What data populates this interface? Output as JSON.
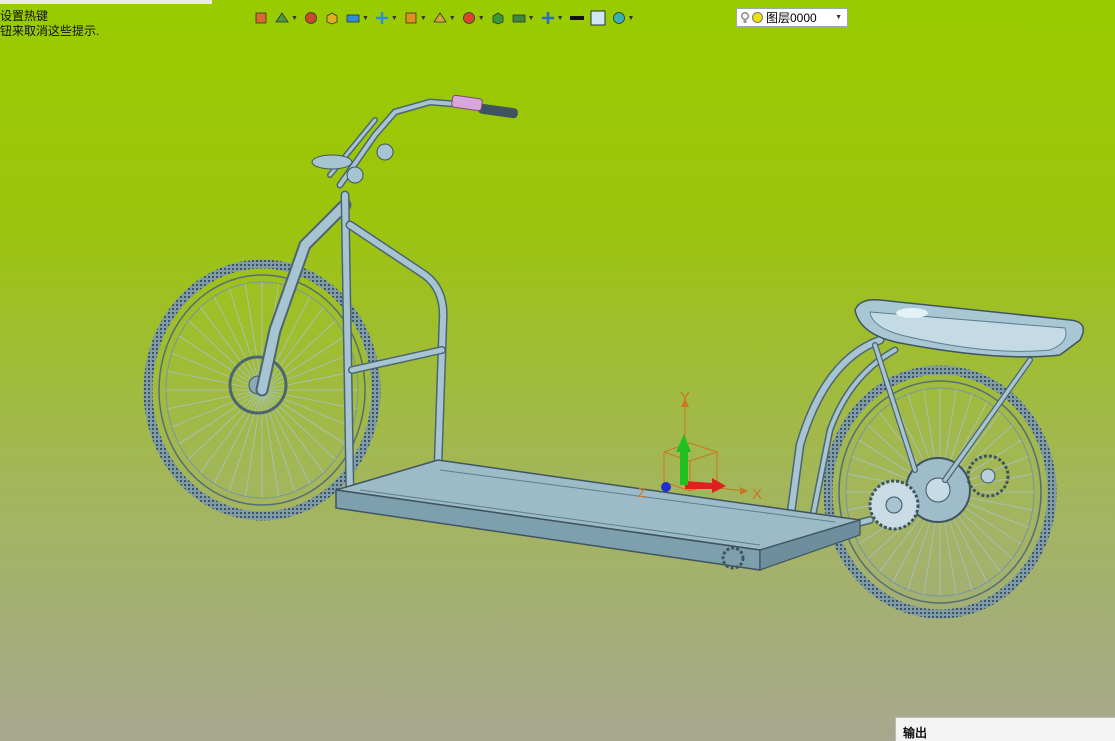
{
  "hint": {
    "line1": "设置热键",
    "line2": "钮来取消这些提示."
  },
  "toolbar": {
    "icons": [
      {
        "name": "import-icon",
        "color": "#d96a2c",
        "dropdown": false
      },
      {
        "name": "sketch-tools-icon",
        "color": "#4a9a3a",
        "dropdown": true
      },
      {
        "name": "line-draw-icon",
        "color": "#c84a2a",
        "dropdown": false
      },
      {
        "name": "extrude-icon",
        "color": "#e0b020",
        "dropdown": false
      },
      {
        "name": "solid-box-icon",
        "color": "#2f8fd6",
        "dropdown": true
      },
      {
        "name": "boolean-icon",
        "color": "#2f8fd6",
        "dropdown": true
      },
      {
        "name": "fillet-icon",
        "color": "#e0901a",
        "dropdown": true
      },
      {
        "name": "shell-icon",
        "color": "#d6a640",
        "dropdown": true
      },
      {
        "name": "datum-point-icon",
        "color": "#d8472a",
        "dropdown": true
      },
      {
        "name": "measure-icon",
        "color": "#3a9a3a",
        "dropdown": false
      },
      {
        "name": "dimension-icon",
        "color": "#3a8a3a",
        "dropdown": true
      },
      {
        "name": "render-icon",
        "color": "#2a6ac8",
        "dropdown": true
      },
      {
        "name": "line-style-icon",
        "color": "#111111",
        "dropdown": false
      },
      {
        "name": "color-swatch-icon",
        "color": "#cfe6f7",
        "dropdown": false
      },
      {
        "name": "layer-manager-icon",
        "color": "#3ab0b0",
        "dropdown": true
      }
    ]
  },
  "layer": {
    "value": "图层0000"
  },
  "viewport": {
    "axis_labels": {
      "x": "X",
      "y": "Y",
      "z": "Z"
    },
    "model_color": "#93b5c4",
    "axis_x_color": "#e02020",
    "axis_y_color": "#20c020",
    "axis_z_color": "#2030d0"
  },
  "output_panel": {
    "title": "输出"
  }
}
